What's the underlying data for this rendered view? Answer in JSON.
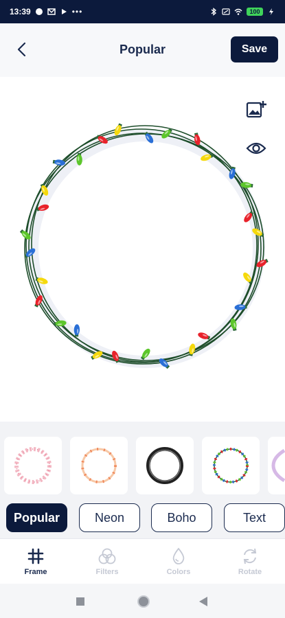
{
  "status_bar": {
    "time": "13:39",
    "battery": "100"
  },
  "header": {
    "title": "Popular",
    "save_label": "Save"
  },
  "canvas": {
    "tools": [
      "add-image-icon",
      "eye-icon"
    ],
    "bulb_colors": [
      "#e8222b",
      "#f5d90c",
      "#2a6fd6",
      "#5cc62b"
    ],
    "wire_color": "#1d4d2a"
  },
  "frame_thumbnails": [
    {
      "name": "pink-floral-wreath"
    },
    {
      "name": "orange-floral-wreath"
    },
    {
      "name": "black-brush-circle"
    },
    {
      "name": "christmas-lights-wreath"
    },
    {
      "name": "purple-floral-wreath"
    }
  ],
  "categories": [
    {
      "label": "Popular",
      "active": true
    },
    {
      "label": "Neon",
      "active": false
    },
    {
      "label": "Boho",
      "active": false
    },
    {
      "label": "Text",
      "active": false
    }
  ],
  "bottom_nav": [
    {
      "label": "Frame",
      "icon": "hash-icon",
      "active": true
    },
    {
      "label": "Filters",
      "icon": "filters-icon",
      "active": false
    },
    {
      "label": "Colors",
      "icon": "drop-icon",
      "active": false
    },
    {
      "label": "Rotate",
      "icon": "rotate-icon",
      "active": false
    }
  ]
}
